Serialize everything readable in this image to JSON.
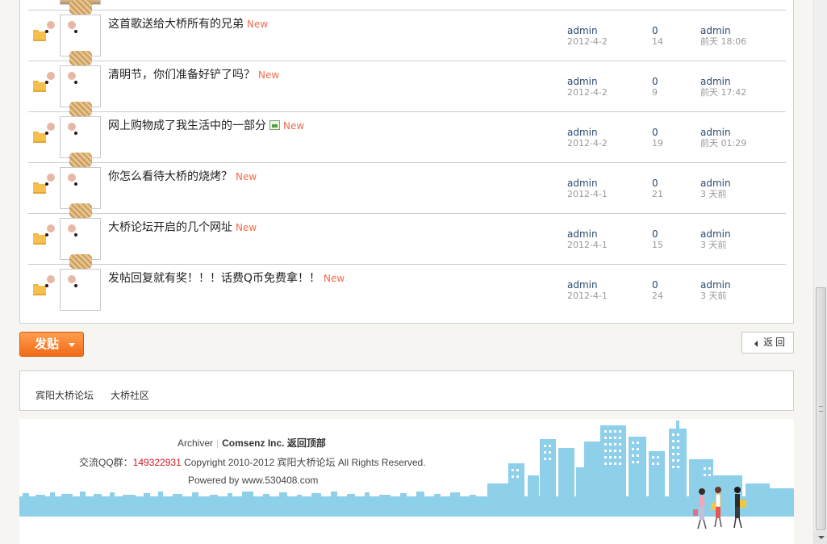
{
  "threads": [
    {
      "title": "这首歌送给大桥所有的兄弟",
      "badge": "New",
      "has_image_icon": false,
      "author": "admin",
      "date": "2012-4-2",
      "replies": "0",
      "views": "14",
      "last_user": "admin",
      "last_time": "前天 18:06"
    },
    {
      "title": "清明节，你们准备好铲了吗？",
      "badge": "New",
      "has_image_icon": false,
      "author": "admin",
      "date": "2012-4-2",
      "replies": "0",
      "views": "9",
      "last_user": "admin",
      "last_time": "前天 17:42"
    },
    {
      "title": "网上购物成了我生活中的一部分",
      "badge": "New",
      "has_image_icon": true,
      "author": "admin",
      "date": "2012-4-2",
      "replies": "0",
      "views": "19",
      "last_user": "admin",
      "last_time": "前天 01:29"
    },
    {
      "title": "你怎么看待大桥的烧烤？",
      "badge": "New",
      "has_image_icon": false,
      "author": "admin",
      "date": "2012-4-1",
      "replies": "0",
      "views": "21",
      "last_user": "admin",
      "last_time": "3 天前"
    },
    {
      "title": "大桥论坛开启的几个网址",
      "badge": "New",
      "has_image_icon": false,
      "author": "admin",
      "date": "2012-4-1",
      "replies": "0",
      "views": "15",
      "last_user": "admin",
      "last_time": "3 天前"
    },
    {
      "title": "发帖回复就有奖！！！话费Q币免费拿！！",
      "badge": "New",
      "has_image_icon": false,
      "author": "admin",
      "date": "2012-4-1",
      "replies": "0",
      "views": "24",
      "last_user": "admin",
      "last_time": "3 天前"
    }
  ],
  "actions": {
    "post_label": "发贴",
    "back_label": "返回"
  },
  "links": {
    "link_1": "宾阳大桥论坛",
    "link_2": "大桥社区"
  },
  "footer": {
    "archiver": "Archiver",
    "separator": "|",
    "comsenz": "Comsenz Inc.",
    "back_to_top": "返回顶部",
    "qq_label": "交流QQ群：",
    "qq_number": "149322931",
    "copyright": "Copyright 2010-2012 宾阳大桥论坛 All Rights Reserved.",
    "powered": "Powered by www.530408.com"
  },
  "colors": {
    "new_badge": "#f26c4f",
    "post_button": "#f06b17",
    "qq_number": "#d0161d",
    "skyline": "#8ecfea"
  },
  "icons": [
    "folder-icon",
    "avatar",
    "image-attachment-icon",
    "caret-down-icon",
    "back-arrow-icon"
  ]
}
